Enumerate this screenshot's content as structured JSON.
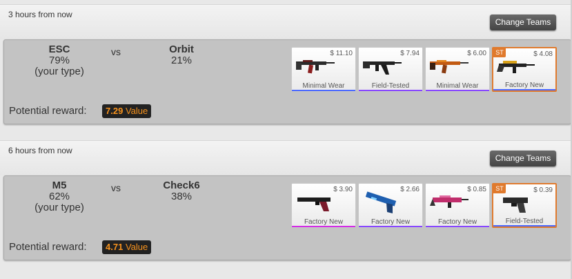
{
  "matches": [
    {
      "time": "3 hours from now",
      "change_label": "Change Teams",
      "team1": {
        "name": "ESC",
        "pct": "79%",
        "note": "(your type)"
      },
      "vs": "vs",
      "team2": {
        "name": "Orbit",
        "pct": "21%"
      },
      "reward_label": "Potential reward:",
      "reward_value": "7.29",
      "reward_unit": "Value",
      "items": [
        {
          "price": "$ 11.10",
          "condition": "Minimal Wear",
          "bar_color": "#4b69ff",
          "icon": "m4-rifle-icon",
          "st": ""
        },
        {
          "price": "$ 7.94",
          "condition": "Field-Tested",
          "bar_color": "#8847ff",
          "icon": "ak-rifle-icon",
          "st": ""
        },
        {
          "price": "$ 6.00",
          "condition": "Minimal Wear",
          "bar_color": "#8847ff",
          "icon": "m4-rifle-orange-icon",
          "st": ""
        },
        {
          "price": "$ 4.08",
          "condition": "Factory New",
          "bar_color": "#4b69ff",
          "icon": "sg-rifle-icon",
          "st": "ST"
        }
      ]
    },
    {
      "time": "6 hours from now",
      "change_label": "Change Teams",
      "team1": {
        "name": "M5",
        "pct": "62%",
        "note": "(your type)"
      },
      "vs": "vs",
      "team2": {
        "name": "Check6",
        "pct": "38%"
      },
      "reward_label": "Potential reward:",
      "reward_value": "4.71",
      "reward_unit": "Value",
      "items": [
        {
          "price": "$ 3.90",
          "condition": "Factory New",
          "bar_color": "#d32ce6",
          "icon": "usp-pistol-icon",
          "st": ""
        },
        {
          "price": "$ 2.66",
          "condition": "Factory New",
          "bar_color": "#8847ff",
          "icon": "deagle-pistol-icon",
          "st": ""
        },
        {
          "price": "$ 0.85",
          "condition": "Factory New",
          "bar_color": "#8847ff",
          "icon": "famas-rifle-icon",
          "st": ""
        },
        {
          "price": "$ 0.39",
          "condition": "Field-Tested",
          "bar_color": "#4b69ff",
          "icon": "glock-pistol-icon",
          "st": "ST"
        }
      ]
    }
  ]
}
